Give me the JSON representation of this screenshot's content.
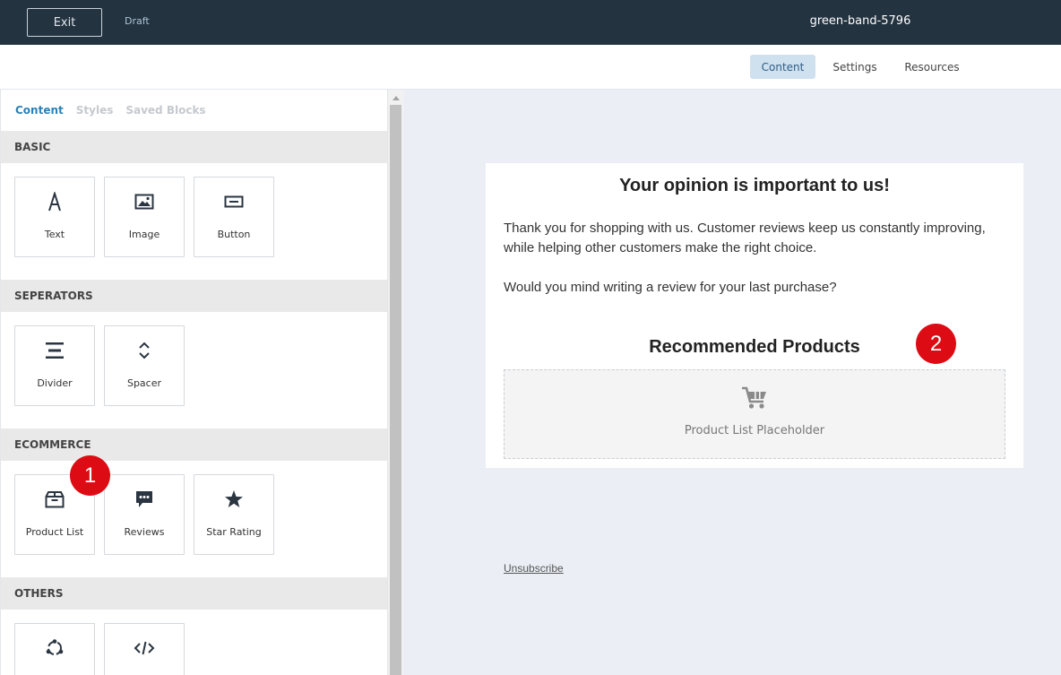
{
  "topbar": {
    "exit_label": "Exit",
    "draft_label": "Draft",
    "doc_title": "green-band-5796",
    "background": "#243340"
  },
  "tabs": [
    {
      "label": "Content",
      "active": true
    },
    {
      "label": "Settings",
      "active": false
    },
    {
      "label": "Resources",
      "active": false
    }
  ],
  "panel": {
    "tabs": [
      {
        "label": "Content",
        "active": true
      },
      {
        "label": "Styles",
        "active": false
      },
      {
        "label": "Saved Blocks",
        "active": false
      }
    ],
    "sections": {
      "basic": {
        "title": "BASIC",
        "items": [
          {
            "label": "Text",
            "icon": "text-icon"
          },
          {
            "label": "Image",
            "icon": "image-icon"
          },
          {
            "label": "Button",
            "icon": "button-icon"
          }
        ]
      },
      "separators": {
        "title": "SEPERATORS",
        "items": [
          {
            "label": "Divider",
            "icon": "divider-icon"
          },
          {
            "label": "Spacer",
            "icon": "spacer-icon"
          }
        ]
      },
      "ecommerce": {
        "title": "ECOMMERCE",
        "items": [
          {
            "label": "Product List",
            "icon": "box-icon"
          },
          {
            "label": "Reviews",
            "icon": "chat-icon"
          },
          {
            "label": "Star Rating",
            "icon": "star-icon"
          }
        ]
      },
      "others": {
        "title": "OTHERS",
        "items": [
          {
            "icon": "social-icon"
          },
          {
            "icon": "code-icon"
          }
        ]
      }
    }
  },
  "email": {
    "heading": "Your opinion is important to us!",
    "paragraph1": "Thank you for shopping with us. Customer reviews keep us constantly improving, while helping other customers make the right choice.",
    "paragraph2": "Would you mind writing a review for your last purchase?",
    "recommended_heading": "Recommended Products",
    "placeholder_text": "Product List Placeholder",
    "placeholder_icon": "cart-icon",
    "unsubscribe": "Unsubscribe"
  },
  "badges": [
    "1",
    "2"
  ],
  "colors": {
    "accent": "#2b82b8",
    "active_tab_bg": "#cfe0ef",
    "badge": "#dd0c14",
    "canvas_bg": "#ebeff5"
  }
}
